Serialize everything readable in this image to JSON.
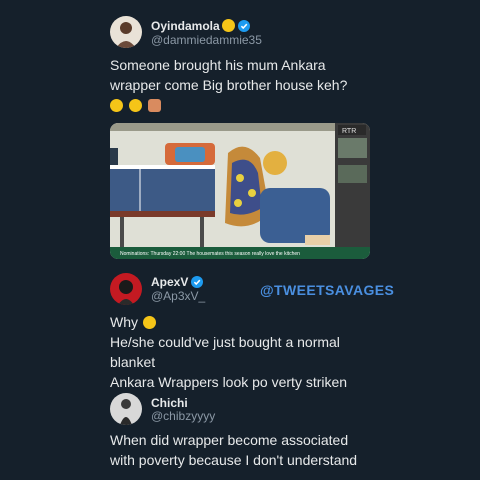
{
  "tweets": [
    {
      "name": "Oyindamola",
      "handle": "@dammiedammie35",
      "text_line1": "Someone brought his mum Ankara",
      "text_line2": "wrapper come Big brother house keh?"
    },
    {
      "name": "ApexV",
      "handle": "@Ap3xV_",
      "line1": "Why",
      "line2": "He/she could've just bought a normal",
      "line3": "blanket",
      "line4": "Ankara Wrappers look po verty striken"
    },
    {
      "name": "Chichi",
      "handle": "@chibzyyyy",
      "line1": "When did wrapper become associated",
      "line2": "with poverty because I don't understand"
    }
  ],
  "watermark": "@TWEETSAVAGES",
  "media": {
    "channel_badge": "RTR",
    "ticker": "Nominations: Thursday 22:00  The housemates this season really love the kitchen"
  },
  "colors": {
    "background": "#15202b",
    "verified": "#1d9bf0",
    "handle": "#8b98a5",
    "watermark": "#4a8fe0"
  }
}
